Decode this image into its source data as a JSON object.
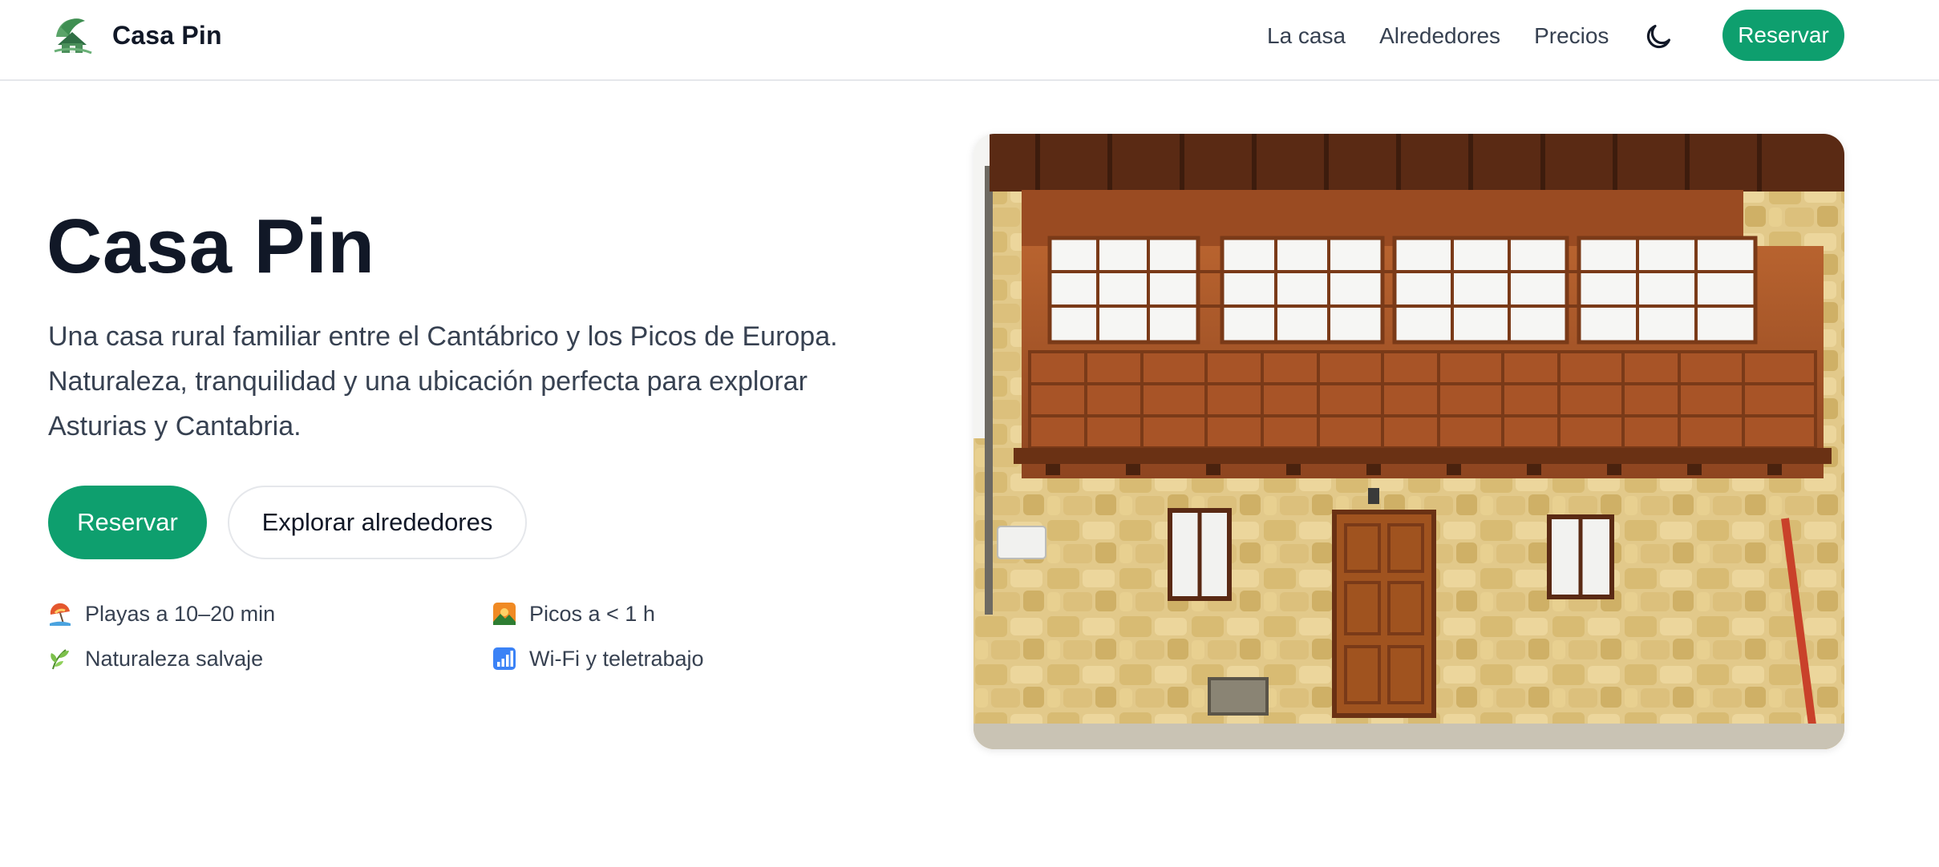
{
  "header": {
    "brand_name": "Casa Pin",
    "logo_icon": "house-leaf-logo-icon",
    "nav": [
      {
        "label": "La casa"
      },
      {
        "label": "Alrededores"
      },
      {
        "label": "Precios"
      }
    ],
    "theme_toggle_icon": "moon-icon",
    "cta_label": "Reservar"
  },
  "hero": {
    "title": "Casa Pin",
    "description_lines": [
      "Una casa rural familiar entre el Cantábrico y los Picos de Europa.",
      "Naturaleza, tranquilidad y una ubicación perfecta para explorar",
      "Asturias y Cantabria."
    ],
    "primary_button": "Reservar",
    "secondary_button": "Explorar alrededores",
    "features": [
      {
        "icon": "beach-umbrella-icon",
        "label": "Playas a 10–20 min"
      },
      {
        "icon": "mountain-sunrise-icon",
        "label": "Picos a < 1 h"
      },
      {
        "icon": "herb-leaf-icon",
        "label": "Naturaleza salvaje"
      },
      {
        "icon": "signal-bars-icon",
        "label": "Wi-Fi y teletrabajo"
      }
    ],
    "image": "stone-house-wooden-balcony-photo"
  },
  "colors": {
    "accent": "#0e9f6e",
    "text_primary": "#111827",
    "text_secondary": "#374151",
    "border": "#e5e7eb"
  }
}
